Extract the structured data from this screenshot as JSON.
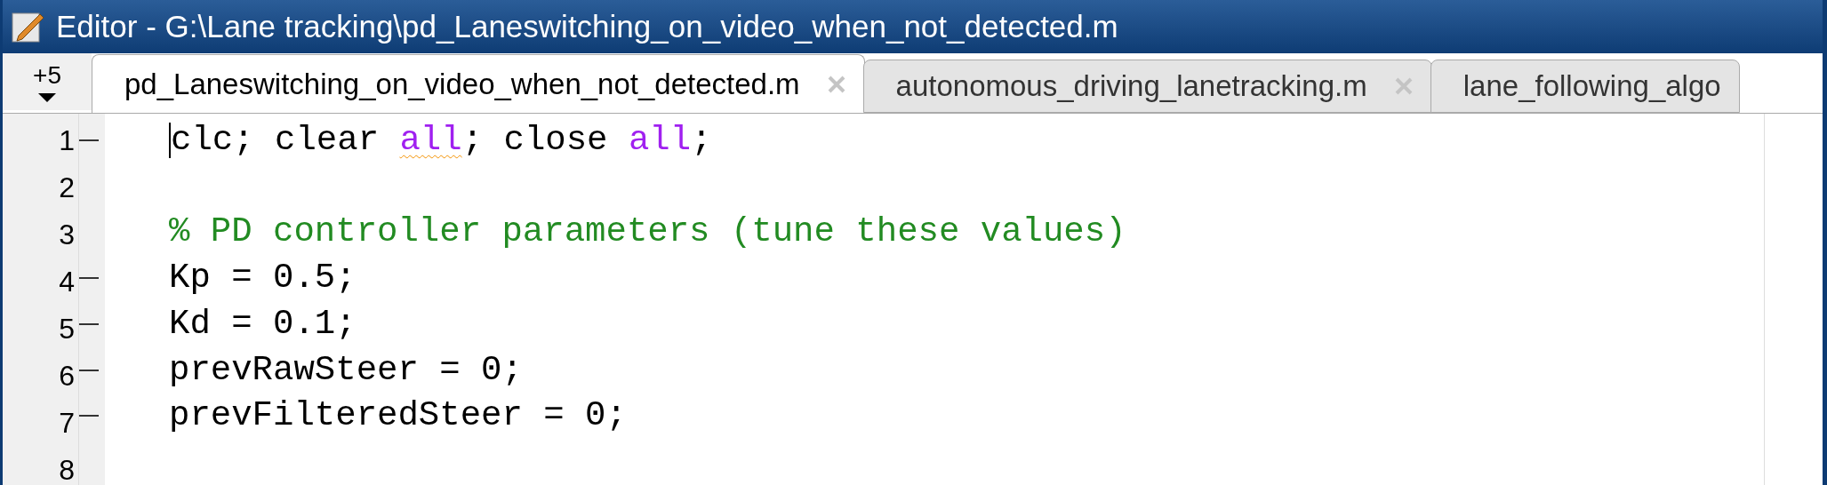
{
  "window": {
    "title": "Editor - G:\\Lane tracking\\pd_Laneswitching_on_video_when_not_detected.m"
  },
  "tab_overflow": {
    "label": "+5"
  },
  "tabs": [
    {
      "label": "pd_Laneswitching_on_video_when_not_detected.m",
      "selected": true,
      "closable": true
    },
    {
      "label": "autonomous_driving_lanetracking.m",
      "selected": false,
      "closable": true
    },
    {
      "label": "lane_following_algo",
      "selected": false,
      "closable": false
    }
  ],
  "lines": [
    {
      "number": "1",
      "executable": true,
      "cursor": true,
      "segments": [
        {
          "kind": "code",
          "text": "clc; clear "
        },
        {
          "kind": "keyword",
          "text": "all",
          "warning": true
        },
        {
          "kind": "code",
          "text": "; close "
        },
        {
          "kind": "keyword",
          "text": "all",
          "warning": false
        },
        {
          "kind": "code",
          "text": ";"
        }
      ]
    },
    {
      "number": "2",
      "executable": false,
      "cursor": false
    },
    {
      "number": "3",
      "executable": false,
      "cursor": false,
      "segments": [
        {
          "kind": "comment",
          "text": "% PD controller parameters (tune these values)"
        }
      ]
    },
    {
      "number": "4",
      "executable": true,
      "cursor": false,
      "segments": [
        {
          "kind": "code",
          "text": "Kp = 0.5;"
        }
      ]
    },
    {
      "number": "5",
      "executable": true,
      "cursor": false,
      "segments": [
        {
          "kind": "code",
          "text": "Kd = 0.1;"
        }
      ]
    },
    {
      "number": "6",
      "executable": true,
      "cursor": false,
      "segments": [
        {
          "kind": "code",
          "text": "prevRawSteer = 0;"
        }
      ]
    },
    {
      "number": "7",
      "executable": true,
      "cursor": false,
      "segments": [
        {
          "kind": "code",
          "text": "prevFilteredSteer = 0;"
        }
      ]
    },
    {
      "number": "8",
      "executable": false,
      "cursor": false
    }
  ]
}
